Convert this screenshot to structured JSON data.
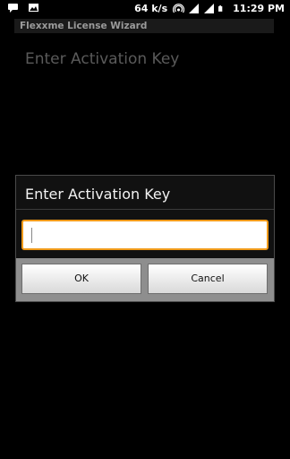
{
  "status_bar": {
    "left_icons": [
      "chat-notification-icon",
      "image-notification-icon"
    ],
    "network_speed": "64 k/s",
    "right_icons": [
      "hotspot-icon",
      "signal-icon",
      "signal-icon",
      "battery-icon"
    ],
    "time": "11:29 PM"
  },
  "app": {
    "title": "Flexxme License Wizard",
    "heading": "Enter Activation Key"
  },
  "dialog": {
    "title": "Enter Activation Key",
    "input_value": "",
    "ok_label": "OK",
    "cancel_label": "Cancel",
    "accent_color": "#f09a1a"
  }
}
